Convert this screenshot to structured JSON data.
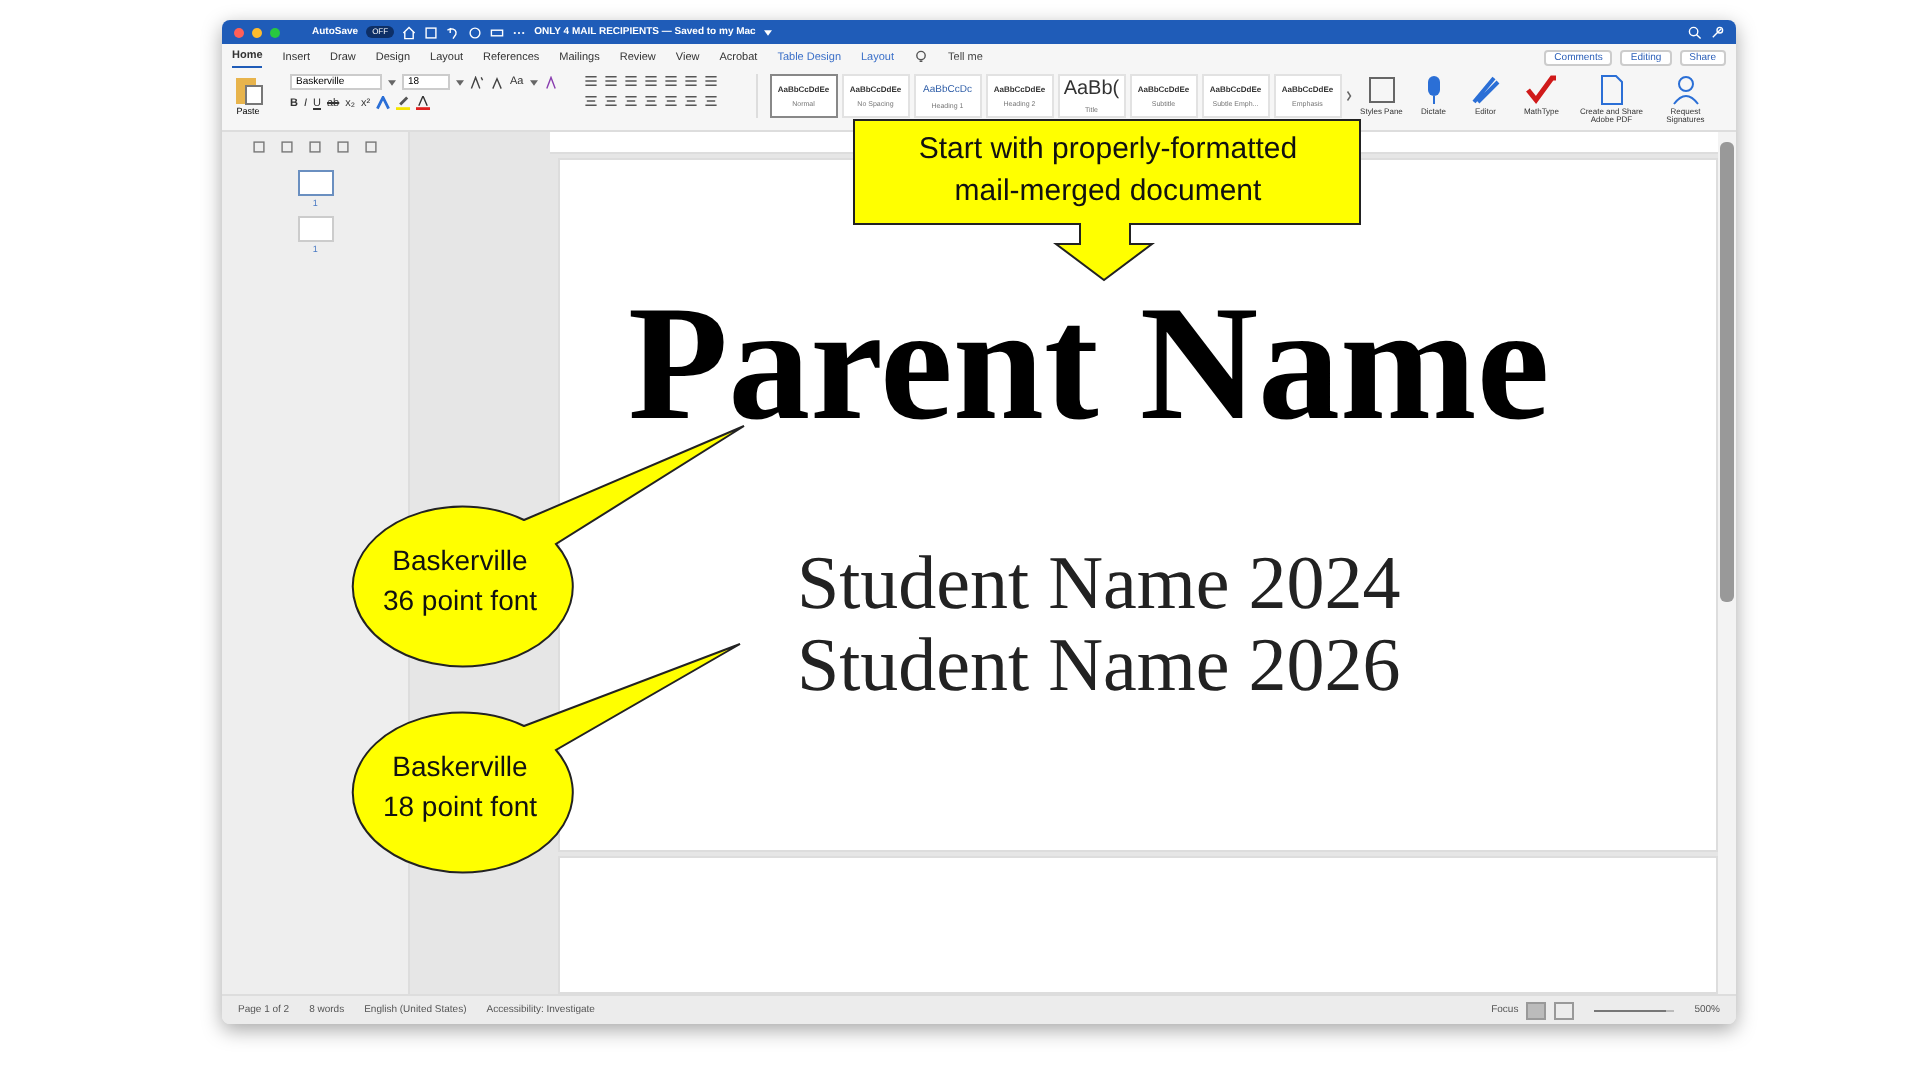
{
  "window": {
    "title": "ONLY 4 MAIL RECIPIENTS — Saved to my Mac",
    "autosave": {
      "label": "AutoSave",
      "state": "OFF",
      "on": false
    }
  },
  "menu_tabs": [
    {
      "label": "Home",
      "selected": true,
      "kind": "main"
    },
    {
      "label": "Insert",
      "selected": false,
      "kind": "main"
    },
    {
      "label": "Draw",
      "selected": false,
      "kind": "main"
    },
    {
      "label": "Design",
      "selected": false,
      "kind": "main"
    },
    {
      "label": "Layout",
      "selected": false,
      "kind": "main"
    },
    {
      "label": "References",
      "selected": false,
      "kind": "main"
    },
    {
      "label": "Mailings",
      "selected": false,
      "kind": "main"
    },
    {
      "label": "Review",
      "selected": false,
      "kind": "main"
    },
    {
      "label": "View",
      "selected": false,
      "kind": "main"
    },
    {
      "label": "Acrobat",
      "selected": false,
      "kind": "main"
    },
    {
      "label": "Table Design",
      "selected": false,
      "kind": "context"
    },
    {
      "label": "Layout",
      "selected": false,
      "kind": "context"
    }
  ],
  "tell_me": "Tell me",
  "header_buttons": [
    "Comments",
    "Editing",
    "Share"
  ],
  "ribbon": {
    "paste": "Paste",
    "font_name": "Baskerville",
    "font_size": "18",
    "case_button": "Aa",
    "format_buttons": [
      "B",
      "I",
      "U",
      "ab",
      "x₂",
      "x²"
    ],
    "styles": [
      {
        "preview": "AaBbCcDdEe",
        "label": "Normal",
        "kind": "small",
        "selected": true
      },
      {
        "preview": "AaBbCcDdEe",
        "label": "No Spacing",
        "kind": "small",
        "selected": false
      },
      {
        "preview": "AaBbCcDc",
        "label": "Heading 1",
        "kind": "heading",
        "selected": false
      },
      {
        "preview": "AaBbCcDdEe",
        "label": "Heading 2",
        "kind": "small",
        "selected": false
      },
      {
        "preview": "AaBb(",
        "label": "Title",
        "kind": "title",
        "selected": false
      },
      {
        "preview": "AaBbCcDdEe",
        "label": "Subtitle",
        "kind": "small",
        "selected": false
      },
      {
        "preview": "AaBbCcDdEe",
        "label": "Subtle Emph...",
        "kind": "small",
        "selected": false
      },
      {
        "preview": "AaBbCcDdEe",
        "label": "Emphasis",
        "kind": "small",
        "selected": false
      }
    ],
    "tools": [
      {
        "label": "Styles Pane",
        "kind": "styles"
      },
      {
        "label": "Dictate",
        "kind": "mic"
      },
      {
        "label": "Editor",
        "kind": "editor"
      },
      {
        "label": "MathType",
        "kind": "math"
      },
      {
        "label": "Create and Share Adobe PDF",
        "kind": "pdf"
      },
      {
        "label": "Request Signatures",
        "kind": "sign"
      }
    ]
  },
  "thumbnails": [
    {
      "page": "1",
      "selected": true
    },
    {
      "page": "1",
      "selected": false
    }
  ],
  "document": {
    "heading": "Parent Name",
    "lines": [
      "Student Name 2024",
      "Student Name 2026"
    ]
  },
  "status_bar": {
    "page": "Page 1 of 2",
    "words": "8 words",
    "language": "English (United States)",
    "accessibility": "Accessibility: Investigate",
    "focus": "Focus",
    "zoom": "500%",
    "zoom_slider": {
      "level": 0.9
    }
  },
  "callouts": [
    {
      "kind": "box",
      "lines": [
        "Start with properly-formatted",
        "mail-merged document"
      ]
    },
    {
      "kind": "bubble",
      "lines": [
        "Baskerville",
        "36 point font"
      ]
    },
    {
      "kind": "bubble",
      "lines": [
        "Baskerville",
        "18 point font"
      ]
    }
  ]
}
